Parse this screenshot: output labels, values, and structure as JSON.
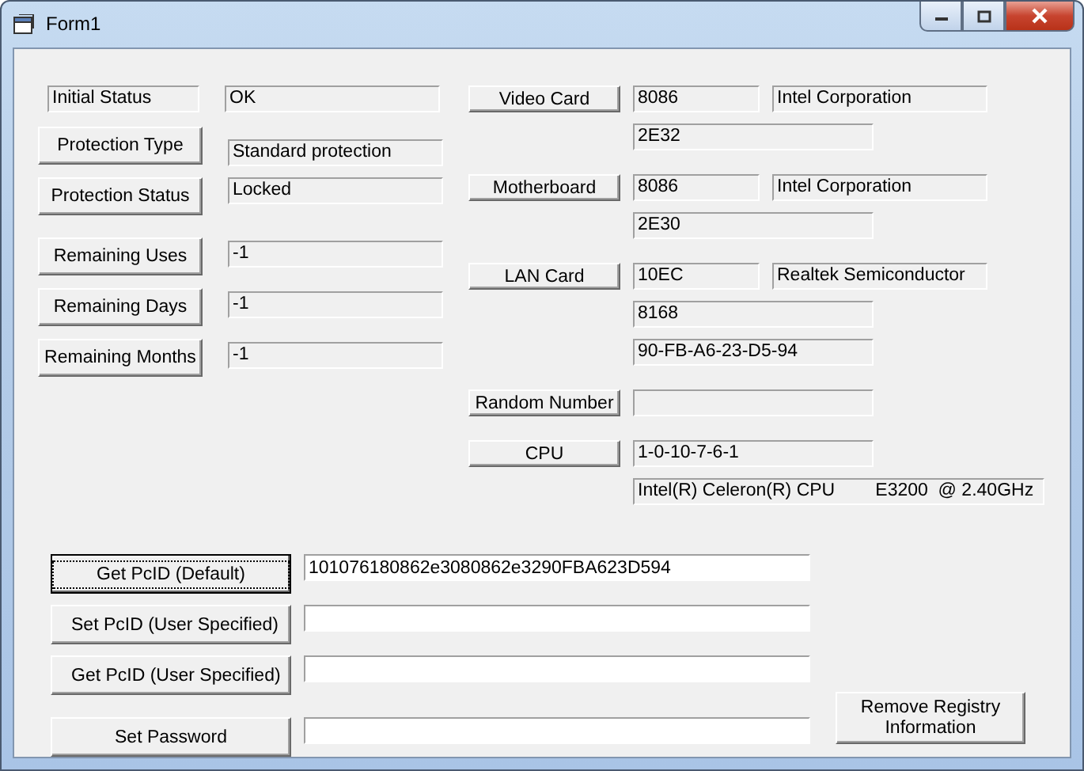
{
  "window": {
    "title": "Form1"
  },
  "status_items": [
    {
      "kind": "label",
      "label": "Initial Status",
      "value": "OK"
    },
    {
      "kind": "button",
      "label": "Protection Type",
      "value": "Standard protection"
    },
    {
      "kind": "button",
      "label": "Protection Status",
      "value": "Locked"
    },
    {
      "kind": "button",
      "label": "Remaining Uses",
      "value": "-1"
    },
    {
      "kind": "button",
      "label": "Remaining Days",
      "value": "-1"
    },
    {
      "kind": "button",
      "label": "Remaining Months",
      "value": "-1"
    }
  ],
  "hardware": [
    {
      "label": "Video Card",
      "lines": [
        [
          {
            "value": "8086"
          },
          {
            "value": "Intel Corporation"
          }
        ],
        [
          {
            "value": "2E32"
          }
        ]
      ]
    },
    {
      "label": "Motherboard",
      "lines": [
        [
          {
            "value": "8086"
          },
          {
            "value": "Intel Corporation"
          }
        ],
        [
          {
            "value": "2E30"
          }
        ]
      ]
    },
    {
      "label": "LAN Card",
      "lines": [
        [
          {
            "value": "10EC"
          },
          {
            "value": "Realtek Semiconductor"
          }
        ],
        [
          {
            "value": "8168"
          }
        ],
        [
          {
            "value": "90-FB-A6-23-D5-94"
          }
        ]
      ]
    },
    {
      "label": "Random Number",
      "blank_field": true
    },
    {
      "label": "CPU",
      "lines": [
        [
          {
            "value": "1-0-10-7-6-1"
          }
        ],
        [
          {
            "value": "Intel(R) Celeron(R) CPU        E3200  @ 2.40GHz"
          }
        ]
      ]
    }
  ],
  "pcid_rows": [
    {
      "button": "Get PcID (Default)",
      "focused": true,
      "value": "101076180862e3080862e3290FBA623D594"
    },
    {
      "button": "Set PcID (User Specified)",
      "focused": false
    },
    {
      "button": "Get PcID (User Specified)",
      "focused": false
    },
    {
      "button": "Set Password",
      "focused": false
    }
  ],
  "side_button": "Remove Registry Information"
}
